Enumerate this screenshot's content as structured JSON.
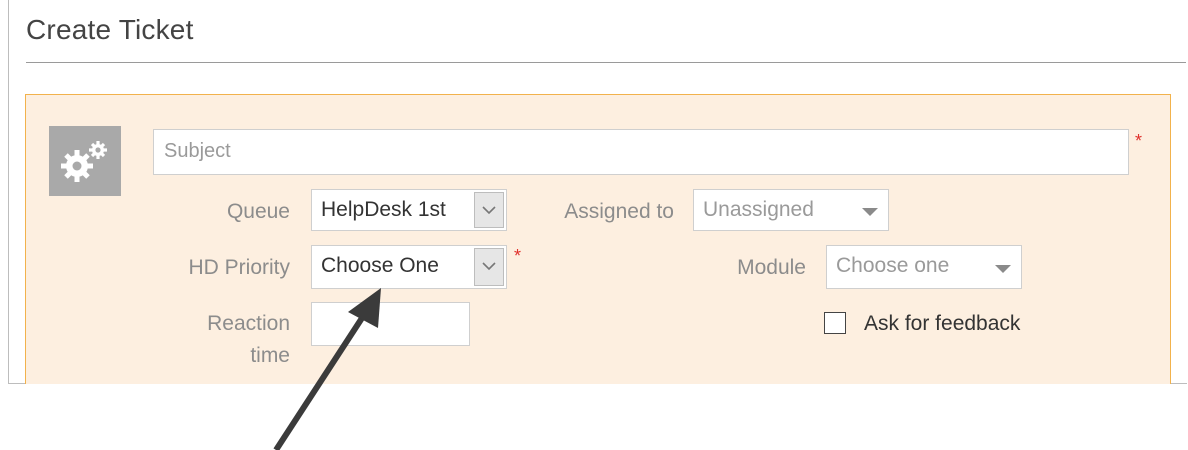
{
  "page": {
    "title": "Create Ticket"
  },
  "form": {
    "subject_placeholder": "Subject",
    "required_mark": "*",
    "queue": {
      "label": "Queue",
      "value": "HelpDesk 1st"
    },
    "assigned_to": {
      "label": "Assigned to",
      "value": "Unassigned"
    },
    "hd_priority": {
      "label": "HD Priority",
      "value": "Choose One"
    },
    "module": {
      "label": "Module",
      "value": "Choose one"
    },
    "reaction_time": {
      "label_line1": "Reaction",
      "label_line2": "time",
      "value": ""
    },
    "ask_feedback": {
      "label": "Ask for feedback",
      "checked": false
    }
  },
  "icons": {
    "form_icon": "gears-icon",
    "dropdown": "chevron-down-icon",
    "annotation": "arrow-pointer"
  },
  "colors": {
    "panel_bg": "#fdefe0",
    "panel_border": "#f2b24c",
    "required": "#e0302c"
  }
}
